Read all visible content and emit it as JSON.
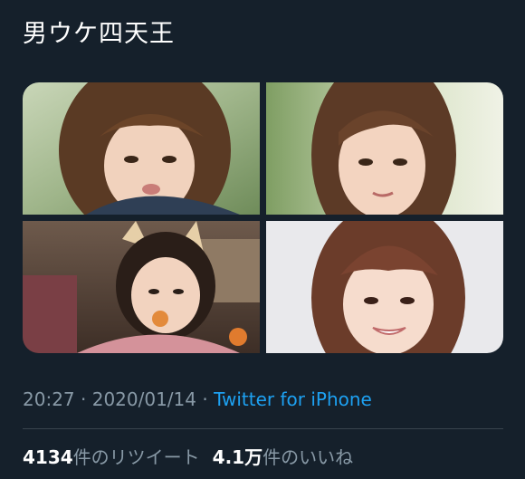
{
  "tweet": {
    "text": "男ウケ四天王",
    "time": "20:27",
    "separator": " · ",
    "date": "2020/01/14",
    "source": "Twitter for iPhone"
  },
  "media": [
    {
      "name": "media-photo-1"
    },
    {
      "name": "media-photo-2"
    },
    {
      "name": "media-photo-3"
    },
    {
      "name": "media-photo-4"
    }
  ],
  "stats": {
    "retweets_count": "4134",
    "retweets_label": "件のリツイート",
    "likes_count": "4.1万",
    "likes_label": "件のいいね"
  },
  "colors": {
    "background": "#15202b",
    "text": "#ffffff",
    "secondary": "#8899a6",
    "link": "#1da1f2",
    "divider": "#38444d"
  }
}
